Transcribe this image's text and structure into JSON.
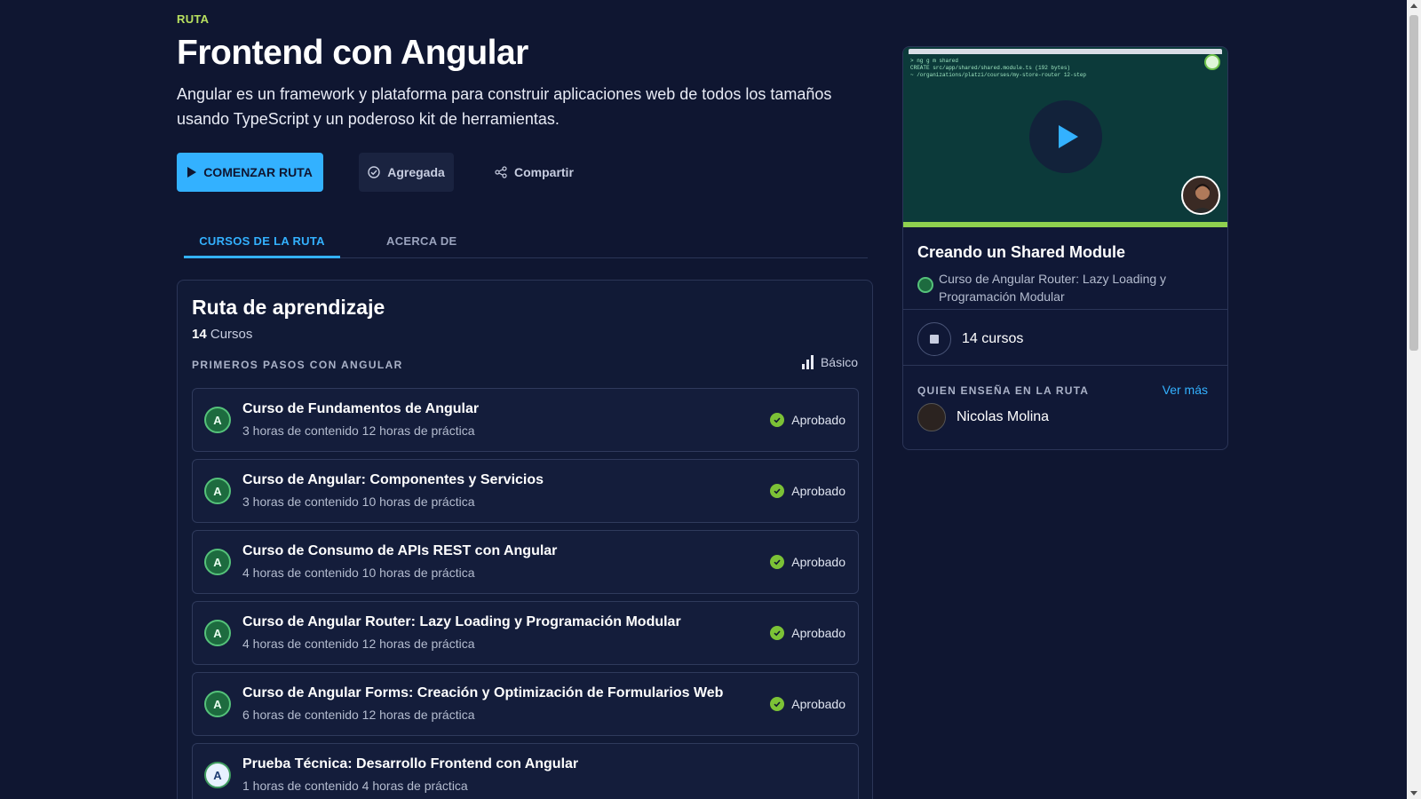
{
  "header": {
    "eyebrow": "RUTA",
    "title": "Frontend con Angular",
    "description": "Angular es un framework y plataforma para construir aplicaciones web de todos los tamaños usando TypeScript y un poderoso kit de herramientas."
  },
  "actions": {
    "start": "COMENZAR RUTA",
    "added": "Agregada",
    "share": "Compartir"
  },
  "tabs": [
    "CURSOS DE LA RUTA",
    "ACERCA DE"
  ],
  "path": {
    "title": "Ruta de aprendizaje",
    "count_number": "14",
    "count_label": "Cursos",
    "section": "PRIMEROS PASOS CON ANGULAR",
    "level": "Básico",
    "courses": [
      {
        "name": "Curso de Fundamentos de Angular",
        "meta": "3 horas de contenido 12 horas de práctica",
        "status": "Aprobado"
      },
      {
        "name": "Curso de Angular: Componentes y Servicios",
        "meta": "3 horas de contenido 10 horas de práctica",
        "status": "Aprobado"
      },
      {
        "name": "Curso de Consumo de APIs REST con Angular",
        "meta": "4 horas de contenido 10 horas de práctica",
        "status": "Aprobado"
      },
      {
        "name": "Curso de Angular Router: Lazy Loading y Programación Modular",
        "meta": "4 horas de contenido 12 horas de práctica",
        "status": "Aprobado"
      },
      {
        "name": "Curso de Angular Forms: Creación y Optimización de Formularios Web",
        "meta": "6 horas de contenido 12 horas de práctica",
        "status": "Aprobado"
      },
      {
        "name": "Prueba Técnica: Desarrollo Frontend con Angular",
        "meta": "1 horas de contenido 4 horas de práctica",
        "status": ""
      }
    ]
  },
  "sidebar": {
    "video_title": "Creando un Shared Module",
    "video_course": "Curso de Angular Router: Lazy Loading y Programación Modular",
    "course_count": "14 cursos",
    "teach_heading": "QUIEN ENSEÑA EN LA RUTA",
    "see_more": "Ver más",
    "teacher": "Nicolas Molina"
  },
  "colors": {
    "background": "#0f1631",
    "accent": "#33b1ff",
    "success": "#7cc236",
    "eyebrow": "#b8e05f"
  }
}
